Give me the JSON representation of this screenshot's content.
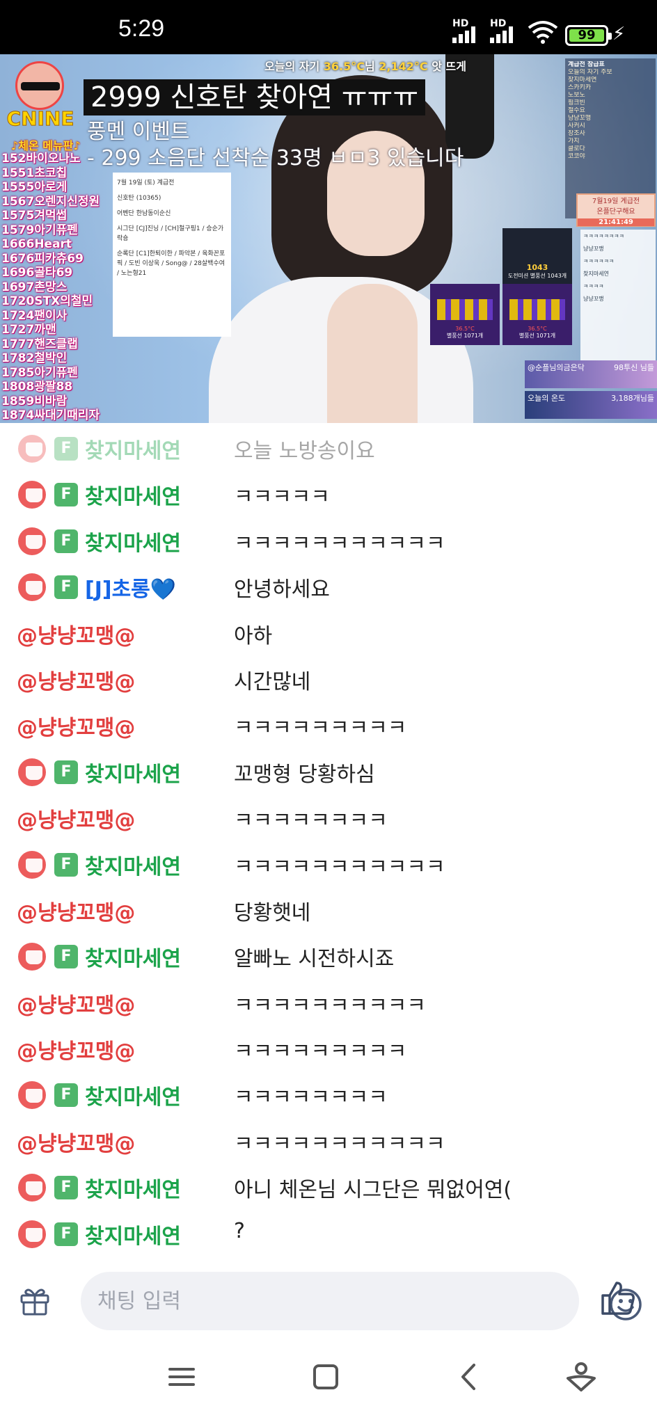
{
  "status_bar": {
    "time": "5:29",
    "sim1": "HD",
    "sim2": "HD",
    "battery": "99"
  },
  "video": {
    "banner": {
      "prefix": "오늘의 자기 ",
      "temp": "36.5°C",
      "mid": "님 ",
      "temp2": "2,142°C",
      "suffix": " 앗 뜨게"
    },
    "title": "2999 신호탄 찾아연 ㅠㅠㅠ",
    "sub1": "풍멘 이벤트",
    "sub2": "- 299 소음단 선착순 33명 ㅂㅁ3 있습니다",
    "logo_text": "CNINE",
    "menu_title": "♪체온 메뉴판♪",
    "menu_items": [
      "152바이오나노",
      "1551초코칩",
      "1555아로게",
      "1567오렌지신정원",
      "1575겨먹썹",
      "1579아기퓨펜",
      "1666Heart",
      "1676피카츄69",
      "1696골타69",
      "1697촌망스",
      "1720STX의철민",
      "1724팬이사",
      "1727까맨",
      "1777핸즈클랩",
      "1782철박인",
      "1785아기퓨펜",
      "1808광팔88",
      "1859비바람",
      "1874싸대기때리자"
    ],
    "notice": [
      "7월 19일 (토) 계급전",
      "신호탄 (10365)",
      "어벤단 한남동이순신",
      "시그단 [CJ]진닝 / [CH]철구핑1 / 승순가락숑",
      "순록단 [C1]한퇴이한 / 파악본 / 육화꼰포픽 / 도빈 이상욱 / Song@ / 28살백수여 / 노는형21"
    ],
    "right_panel_title": "계급전 참급표",
    "right_panel_lines": [
      "오늘의 자기 주보",
      "찾지마세연",
      "스카키카",
      "노보노",
      "핑크빈",
      "철수요",
      "냥냥꼬맹",
      "사커시",
      "장조사",
      "가지",
      "클로다",
      "코코야"
    ],
    "date_card": {
      "title": "7월19일 계급전",
      "line": "온플단구해요",
      "time": "21:41:49"
    },
    "chat_mini": [
      "ㅋㅋㅋㅋㅋㅋㅋㅋ",
      "냥냥꼬맹",
      "ㅋㅋㅋㅋㅋㅋ",
      "찾지마세연",
      "ㅋㅋㅋㅋ",
      "냥냥꼬맹"
    ],
    "mission": {
      "count": "1043",
      "label": "도전미션 별풍선 1043개"
    },
    "cards": [
      {
        "temp": "36.5°C",
        "label": "별풍선 1071개"
      },
      {
        "temp": "36.5°C",
        "label": "별풍선 1071개"
      }
    ],
    "stats": [
      {
        "label": "@순플님의금은닥",
        "value": "98투신 님들"
      },
      {
        "label": "오늘의 온도",
        "value": "3,188개님들"
      }
    ]
  },
  "chat": [
    {
      "type": "fan",
      "nick": "찾지마세연",
      "msg": "오늘 노방송이요",
      "faded": true
    },
    {
      "type": "fan",
      "nick": "찾지마세연",
      "msg": "ㅋㅋㅋㅋㅋ"
    },
    {
      "type": "fan",
      "nick": "찾지마세연",
      "msg": "ㅋㅋㅋㅋㅋㅋㅋㅋㅋㅋㅋ"
    },
    {
      "type": "fan-blue",
      "nick": "[J]초롱💙",
      "msg": "안녕하세요"
    },
    {
      "type": "plain",
      "nick": "@냥냥꼬맹@",
      "msg": "아하"
    },
    {
      "type": "plain",
      "nick": "@냥냥꼬맹@",
      "msg": "시간많네"
    },
    {
      "type": "plain",
      "nick": "@냥냥꼬맹@",
      "msg": "ㅋㅋㅋㅋㅋㅋㅋㅋㅋ"
    },
    {
      "type": "fan",
      "nick": "찾지마세연",
      "msg": "꼬맹형 당황하심"
    },
    {
      "type": "plain",
      "nick": "@냥냥꼬맹@",
      "msg": "ㅋㅋㅋㅋㅋㅋㅋㅋ"
    },
    {
      "type": "fan",
      "nick": "찾지마세연",
      "msg": "ㅋㅋㅋㅋㅋㅋㅋㅋㅋㅋㅋ"
    },
    {
      "type": "plain",
      "nick": "@냥냥꼬맹@",
      "msg": "당황햇네"
    },
    {
      "type": "fan",
      "nick": "찾지마세연",
      "msg": "알빠노 시전하시죠"
    },
    {
      "type": "plain",
      "nick": "@냥냥꼬맹@",
      "msg": "ㅋㅋㅋㅋㅋㅋㅋㅋㅋㅋ"
    },
    {
      "type": "plain",
      "nick": "@냥냥꼬맹@",
      "msg": "ㅋㅋㅋㅋㅋㅋㅋㅋㅋ"
    },
    {
      "type": "fan",
      "nick": "찾지마세연",
      "msg": "ㅋㅋㅋㅋㅋㅋㅋㅋ"
    },
    {
      "type": "plain",
      "nick": "@냥냥꼬맹@",
      "msg": "ㅋㅋㅋㅋㅋㅋㅋㅋㅋㅋㅋ"
    },
    {
      "type": "fan",
      "nick": "찾지마세연",
      "msg": "아니 체온님 시그단은 뭐없어연("
    },
    {
      "type": "fan",
      "nick": "찾지마세연",
      "msg": "?"
    }
  ],
  "input": {
    "placeholder": "채팅 입력",
    "value": ""
  },
  "fan_badge": "F",
  "colors": {
    "fan_nick": "#1ba34a",
    "plain_nick": "#e23f3f",
    "blue_nick": "#1565e6",
    "badge": "#4fb56b",
    "cup": "#ec5c5c"
  },
  "icons": {
    "gift": "gift-icon",
    "emoji": "smiley-icon",
    "like": "thumbs-up-icon",
    "nav_menu": "menu-icon",
    "nav_home": "square-home-icon",
    "nav_back": "back-chevron-icon",
    "nav_assistant": "person-assistant-icon"
  }
}
